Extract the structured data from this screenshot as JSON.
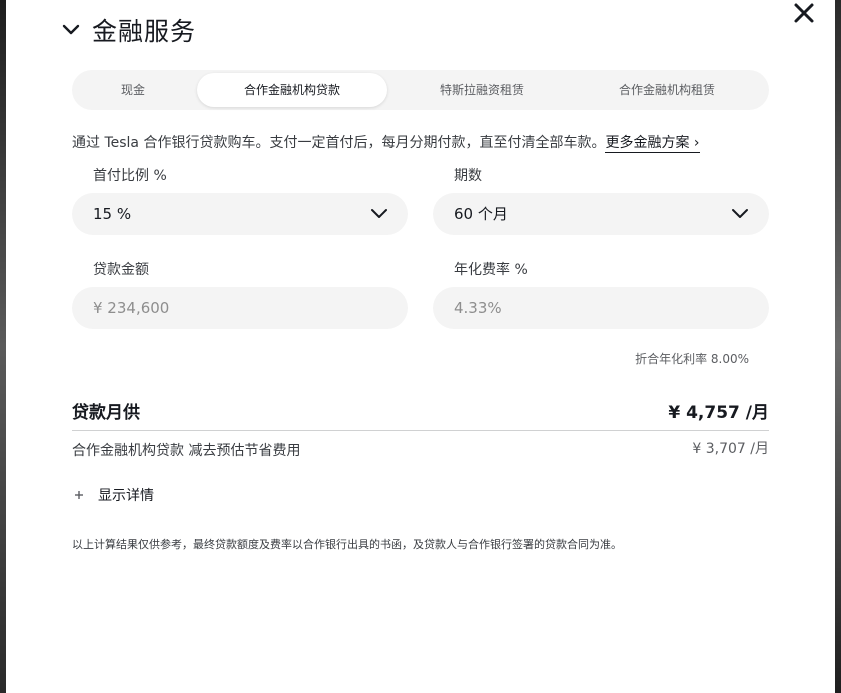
{
  "header": {
    "title": "金融服务"
  },
  "tabs": [
    {
      "label": "现金",
      "active": false
    },
    {
      "label": "合作金融机构贷款",
      "active": true
    },
    {
      "label": "特斯拉融资租赁",
      "active": false
    },
    {
      "label": "合作金融机构租赁",
      "active": false
    }
  ],
  "description": {
    "text": "通过 Tesla 合作银行贷款购车。支付一定首付后，每月分期付款，直至付清全部车款。",
    "link_label": "更多金融方案 ›"
  },
  "fields": {
    "down_payment": {
      "label": "首付比例 %",
      "value": "15 %"
    },
    "term": {
      "label": "期数",
      "value": "60 个月"
    },
    "loan_amount": {
      "label": "贷款金额",
      "value": "¥ 234,600"
    },
    "rate": {
      "label": "年化费率 %",
      "value": "4.33%"
    }
  },
  "apr_note": "折合年化利率 8.00%",
  "monthly": {
    "label": "贷款月供",
    "value": "¥ 4,757 /月"
  },
  "savings": {
    "label": "合作金融机构贷款 减去预估节省费用",
    "value": "¥ 3,707 /月"
  },
  "details_toggle": {
    "label": "显示详情",
    "icon": "plus-icon"
  },
  "disclaimer": "以上计算结果仅供参考，最终贷款额度及费率以合作银行出具的书函，及贷款人与合作银行签署的贷款合同为准。",
  "icons": {
    "collapse": "chevron-down-icon",
    "close": "close-icon",
    "dropdown": "chevron-down-icon"
  },
  "colors": {
    "text": "#171a20",
    "field_bg": "#f4f4f4",
    "tab_bg": "#f4f4f4",
    "muted": "#5c5e62"
  }
}
